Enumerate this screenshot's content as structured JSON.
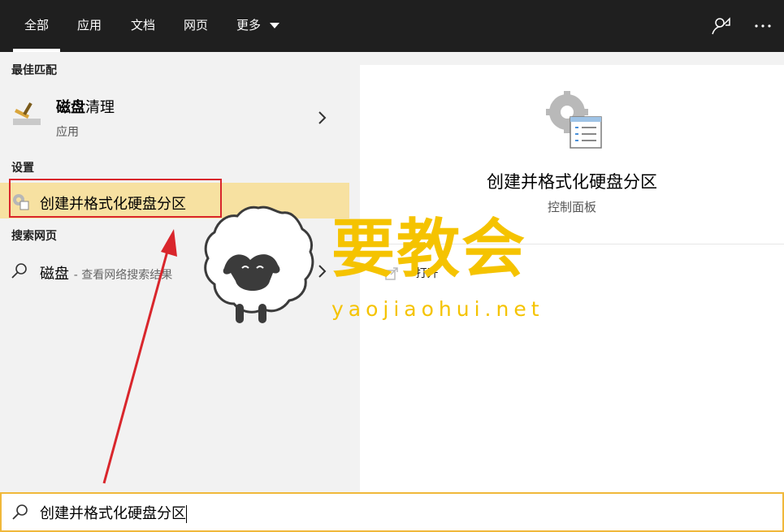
{
  "tabs": [
    {
      "label": "全部",
      "active": true
    },
    {
      "label": "应用",
      "active": false
    },
    {
      "label": "文档",
      "active": false
    },
    {
      "label": "网页",
      "active": false
    },
    {
      "label": "更多",
      "active": false
    }
  ],
  "sections": {
    "best_match": "最佳匹配",
    "settings": "设置",
    "web": "搜索网页"
  },
  "best_match_item": {
    "title_bold": "磁盘",
    "title_rest": "清理",
    "subtitle": "应用"
  },
  "settings_item": {
    "title": "创建并格式化硬盘分区"
  },
  "web_item": {
    "query": "磁盘",
    "suffix": "- 查看网络搜索结果"
  },
  "detail": {
    "title": "创建并格式化硬盘分区",
    "subtitle": "控制面板",
    "action": "打开"
  },
  "search": {
    "value": "创建并格式化硬盘分区"
  },
  "watermark": {
    "title": "要教会",
    "url": "yaojiaohui.net"
  },
  "colors": {
    "highlight": "#f7e1a1",
    "annotation": "#d9262c",
    "accent": "#f0b83a",
    "watermark": "#f5c300"
  }
}
